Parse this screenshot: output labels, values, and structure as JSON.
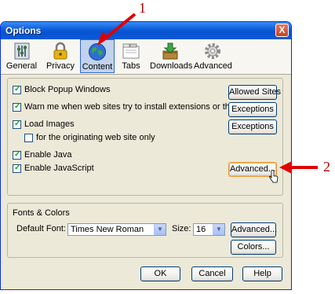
{
  "window": {
    "title": "Options",
    "close_label": "X"
  },
  "toolbar": {
    "items": [
      {
        "label": "General",
        "icon": "general-icon"
      },
      {
        "label": "Privacy",
        "icon": "lock-icon"
      },
      {
        "label": "Content",
        "icon": "globe-icon",
        "selected": true
      },
      {
        "label": "Tabs",
        "icon": "tabs-icon"
      },
      {
        "label": "Downloads",
        "icon": "downloads-icon"
      },
      {
        "label": "Advanced",
        "icon": "gear-icon"
      }
    ]
  },
  "content": {
    "options": [
      {
        "label": "Block Popup Windows",
        "checked": true
      },
      {
        "label": "Warn me when web sites try to install extensions or themes",
        "checked": true
      },
      {
        "label": "Load Images",
        "checked": true
      },
      {
        "label": "for the originating web site only",
        "checked": false
      },
      {
        "label": "Enable Java",
        "checked": true
      },
      {
        "label": "Enable JavaScript",
        "checked": true
      }
    ],
    "buttons": {
      "allowed_sites": "Allowed Sites",
      "exceptions_1": "Exceptions",
      "exceptions_2": "Exceptions",
      "advanced_js": "Advanced..."
    }
  },
  "fonts_colors": {
    "legend": "Fonts & Colors",
    "default_font_label": "Default Font:",
    "default_font_value": "Times New Roman",
    "size_label": "Size:",
    "size_value": "16",
    "advanced_label": "Advanced...",
    "colors_label": "Colors..."
  },
  "footer": {
    "ok": "OK",
    "cancel": "Cancel",
    "help": "Help"
  },
  "annotations": {
    "callout_1": "1",
    "callout_2": "2",
    "arrow_color": "#e00000"
  }
}
